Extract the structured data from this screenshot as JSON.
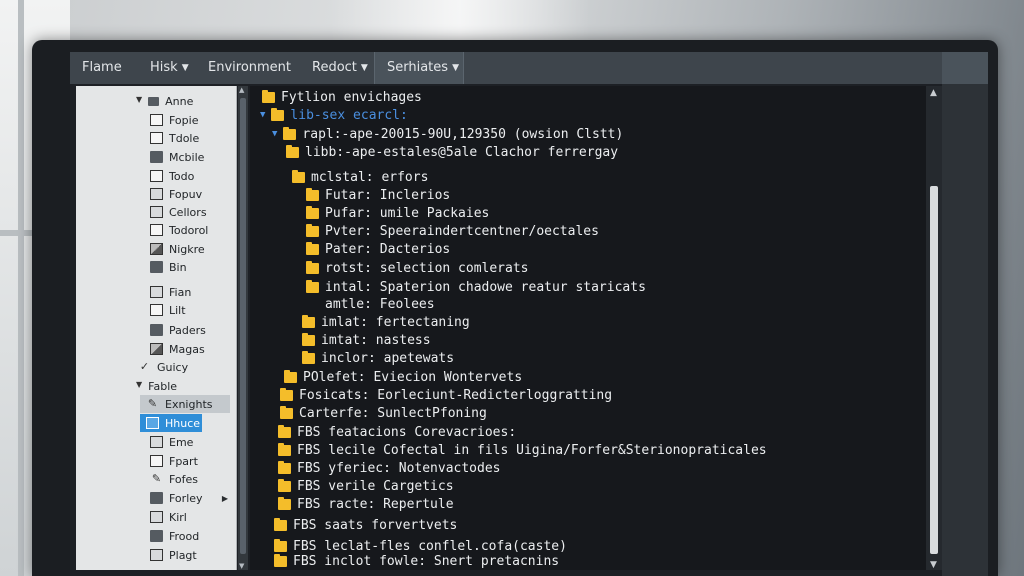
{
  "menubar": {
    "items": [
      {
        "label": "Flame",
        "dropdown": false
      },
      {
        "label": "Hisk",
        "dropdown": true
      },
      {
        "label": "Environment",
        "dropdown": false
      },
      {
        "label": "Redoct",
        "dropdown": true
      },
      {
        "label": "Serhiates",
        "dropdown": true
      }
    ]
  },
  "sidebar": {
    "items": [
      {
        "label": "Anne",
        "icon": "caret-home-icon"
      },
      {
        "label": "Fopie",
        "icon": "document-icon"
      },
      {
        "label": "Tdole",
        "icon": "document-icon"
      },
      {
        "label": "Mcbile",
        "icon": "folder-icon"
      },
      {
        "label": "Todo",
        "icon": "document-icon"
      },
      {
        "label": "Fopuv",
        "icon": "box-icon"
      },
      {
        "label": "Cellors",
        "icon": "box-icon"
      },
      {
        "label": "Todorol",
        "icon": "document-icon"
      },
      {
        "label": "Nigkre",
        "icon": "image-icon"
      },
      {
        "label": "Bin",
        "icon": "folder-icon"
      },
      {
        "label": "Fian",
        "icon": "box-icon"
      },
      {
        "label": "Lilt",
        "icon": "document-icon"
      },
      {
        "label": "Paders",
        "icon": "folder-icon"
      },
      {
        "label": "Magas",
        "icon": "image-icon"
      },
      {
        "label": "Guicy",
        "icon": "check-icon"
      },
      {
        "label": "Fable",
        "icon": "caret-down-icon"
      },
      {
        "label": "Exnights",
        "icon": "pencil-icon"
      },
      {
        "label": "Hhuce",
        "icon": "box-icon"
      },
      {
        "label": "Eme",
        "icon": "box-icon"
      },
      {
        "label": "Fpart",
        "icon": "document-icon"
      },
      {
        "label": "Fofes",
        "icon": "pencil-icon"
      },
      {
        "label": "Forley",
        "icon": "folder-icon"
      },
      {
        "label": "Kirl",
        "icon": "box-icon"
      },
      {
        "label": "Frood",
        "icon": "folder-icon"
      },
      {
        "label": "Plagt",
        "icon": "box-icon"
      }
    ]
  },
  "tree": {
    "rows": [
      {
        "text": "Fytlion envichages"
      },
      {
        "text": "lib-sex ecarcl:"
      },
      {
        "text": "rapl:-ape-20015-90U,129350 (owsion Clstt)"
      },
      {
        "text": "libb:-ape-estales@5ale Clachor ferrergay"
      },
      {
        "text": "mclstal: erfors"
      },
      {
        "text": "Futar: Inclerios"
      },
      {
        "text": "Pufar: umile Packaies"
      },
      {
        "text": "Pvter: Speeraindertcentner/oectales"
      },
      {
        "text": "Pater: Dacterios"
      },
      {
        "text": "rotst: selection comlerats"
      },
      {
        "text": "intal: Spaterion chadowe reatur staricats"
      },
      {
        "text": "amtle: Feolees"
      },
      {
        "text": "imlat: fertectaning"
      },
      {
        "text": "imtat: nastess"
      },
      {
        "text": "inclor: apetewats"
      },
      {
        "text": "POlefet: Eviecion Wontervets"
      },
      {
        "text": "Fosicats: Eorleciunt-Redicterloggratting"
      },
      {
        "text": "Carterfe: SunlectPfoning"
      },
      {
        "text": "FBS featacions Corevacrioes:"
      },
      {
        "text": "FBS lecile Cofectal in fils Uigina/Forfer&Sterionopraticales"
      },
      {
        "text": "FBS yferiec: Notenvactodes"
      },
      {
        "text": "FBS verile Cargetics"
      },
      {
        "text": "FBS racte: Repertule"
      },
      {
        "text": "FBS saats forvertvets"
      },
      {
        "text": "FBS leclat-fles conflel.cofa(caste)"
      },
      {
        "text": "FBS inclot fowle: Snert pretacnins"
      }
    ]
  },
  "colors": {
    "folder": "#f4bd2a",
    "selected": "#2f8ed8",
    "link_blue": "#4a8fe0",
    "terminal_bg": "#16181c"
  }
}
